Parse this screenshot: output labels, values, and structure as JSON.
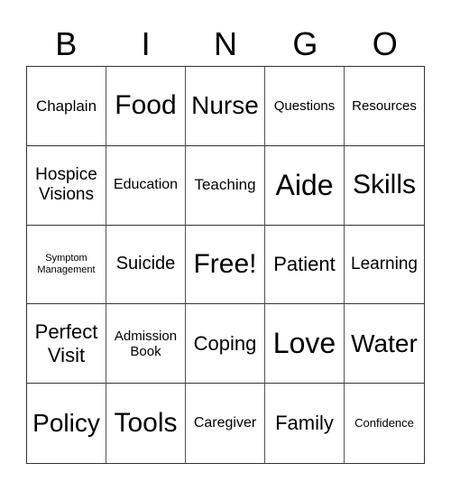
{
  "header": [
    "B",
    "I",
    "N",
    "G",
    "O"
  ],
  "cells": [
    "Chaplain",
    "Food",
    "Nurse",
    "Questions",
    "Resources",
    "Hospice Visions",
    "Education",
    "Teaching",
    "Aide",
    "Skills",
    "Symptom Management",
    "Suicide",
    "Free!",
    "Patient",
    "Learning",
    "Perfect Visit",
    "Admission Book",
    "Coping",
    "Love",
    "Water",
    "Policy",
    "Tools",
    "Caregiver",
    "Family",
    "Confidence"
  ]
}
